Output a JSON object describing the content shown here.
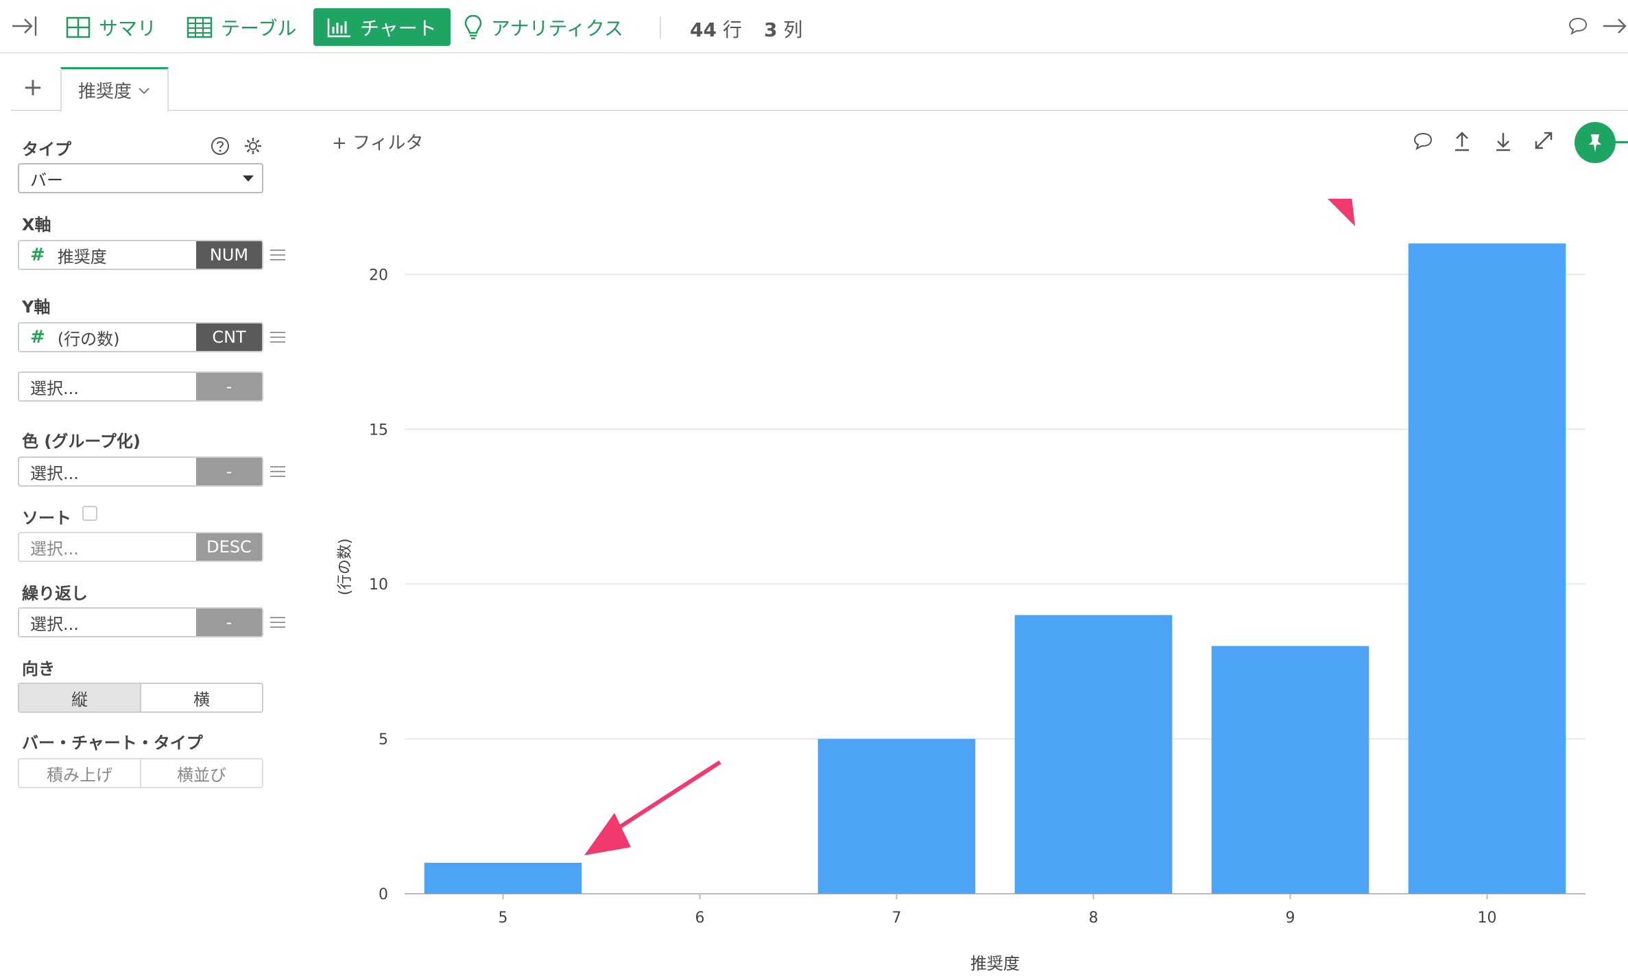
{
  "toolbar": {
    "summary": "サマリ",
    "table": "テーブル",
    "chart": "チャート",
    "analytics": "アナリティクス",
    "rows_value": "44",
    "rows_unit": "行",
    "cols_value": "3",
    "cols_unit": "列"
  },
  "tabs": {
    "add": "+",
    "active_label": "推奨度"
  },
  "panel": {
    "type_label": "タイプ",
    "type_value": "バー",
    "x_label": "X軸",
    "x_field": "推奨度",
    "x_agg": "NUM",
    "y_label": "Y軸",
    "y_field": "(行の数)",
    "y_agg": "CNT",
    "y2_placeholder": "選択...",
    "y2_agg": "-",
    "color_label": "色 (グループ化)",
    "color_placeholder": "選択...",
    "color_agg": "-",
    "sort_label": "ソート",
    "sort_placeholder": "選択...",
    "sort_dir": "DESC",
    "repeat_label": "繰り返し",
    "repeat_placeholder": "選択...",
    "repeat_agg": "-",
    "orient_label": "向き",
    "orient_vertical": "縦",
    "orient_horizontal": "横",
    "bartype_label": "バー・チャート・タイプ",
    "bartype_stacked": "積み上げ",
    "bartype_side": "横並び",
    "hash": "#"
  },
  "filter_label": "+ フィルタ",
  "colors": {
    "brand": "#1fa463",
    "bar": "#4da4f7",
    "arrow": "#f0396d"
  },
  "chart_data": {
    "type": "bar",
    "categories": [
      "5",
      "6",
      "7",
      "8",
      "9",
      "10"
    ],
    "values": [
      1,
      0,
      5,
      9,
      8,
      21
    ],
    "xlabel": "推奨度",
    "ylabel": "(行の数)",
    "ylim": [
      0,
      22
    ],
    "yticks": [
      0,
      5,
      10,
      15,
      20
    ],
    "grid": true
  }
}
